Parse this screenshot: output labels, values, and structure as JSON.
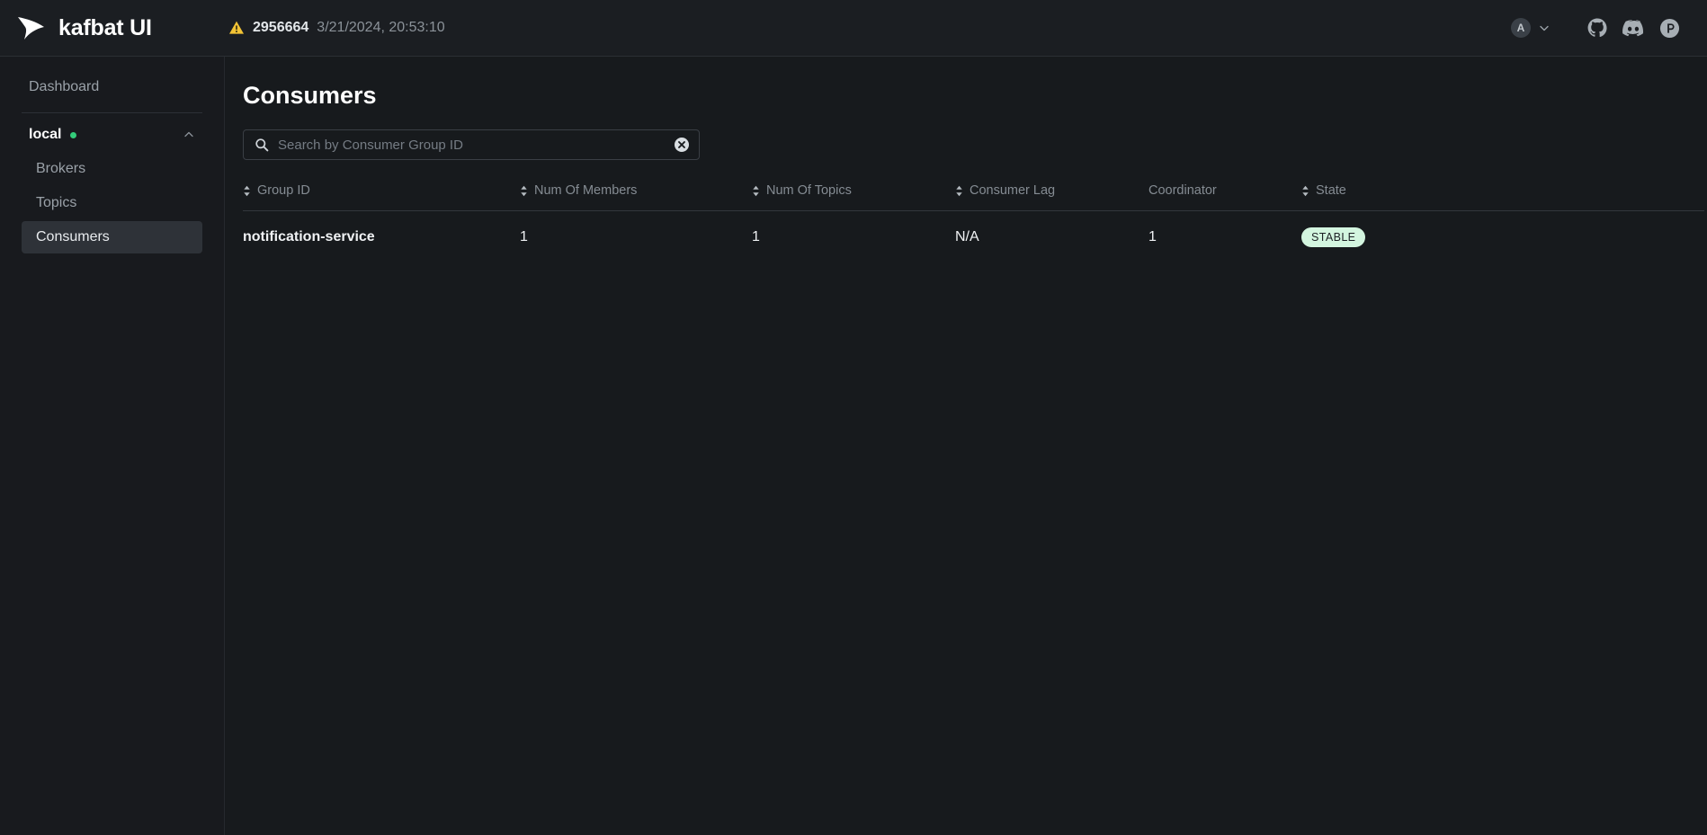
{
  "topbar": {
    "logo_icon": "kafbat-arrow-logo",
    "brand": "kafbat UI",
    "warning_icon": "warning-triangle-icon",
    "version": "2956664",
    "version_date": "3/21/2024, 20:53:10",
    "avatar_initial": "A",
    "avatar_chevron_icon": "chevron-down-icon",
    "links": [
      {
        "name": "github-icon",
        "label": "GitHub"
      },
      {
        "name": "discord-icon",
        "label": "Discord"
      },
      {
        "name": "producthunt-icon",
        "label": "ProductHunt"
      }
    ]
  },
  "sidebar": {
    "dashboard_label": "Dashboard",
    "cluster": {
      "name": "local",
      "status_color": "#33cc7a",
      "chevron_icon": "chevron-up-icon"
    },
    "items": [
      {
        "label": "Brokers",
        "active": false
      },
      {
        "label": "Topics",
        "active": false
      },
      {
        "label": "Consumers",
        "active": true
      }
    ]
  },
  "main": {
    "title": "Consumers",
    "search": {
      "placeholder": "Search by Consumer Group ID",
      "value": "",
      "icon": "search-icon",
      "clear_icon": "clear-circle-icon"
    },
    "table": {
      "columns": [
        {
          "label": "Group ID",
          "sortable": true
        },
        {
          "label": "Num Of Members",
          "sortable": true
        },
        {
          "label": "Num Of Topics",
          "sortable": true
        },
        {
          "label": "Consumer Lag",
          "sortable": true
        },
        {
          "label": "Coordinator",
          "sortable": false
        },
        {
          "label": "State",
          "sortable": true
        }
      ],
      "rows": [
        {
          "group_id": "notification-service",
          "num_of_members": "1",
          "num_of_topics": "1",
          "consumer_lag": "N/A",
          "coordinator": "1",
          "state": "STABLE",
          "state_bg": "#d3f5df"
        }
      ]
    }
  }
}
